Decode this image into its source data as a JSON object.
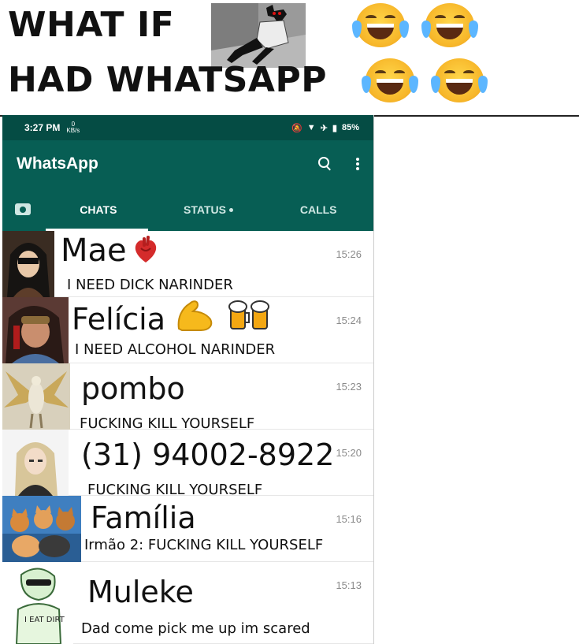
{
  "meme": {
    "line1": "WHAT IF",
    "line2": "HAD WHATSAPP"
  },
  "statusbar": {
    "time": "3:27 PM",
    "speed_value": "0",
    "speed_unit": "KB/s",
    "battery": "85%"
  },
  "appbar": {
    "title": "WhatsApp"
  },
  "tabs": [
    {
      "label": "CHATS",
      "active": true
    },
    {
      "label": "STATUS",
      "active": false
    },
    {
      "label": "CALLS",
      "active": false
    }
  ],
  "chats": [
    {
      "name": "Mae",
      "preview": "I NEED DICK NARINDER",
      "time": "15:26"
    },
    {
      "name": "Felícia",
      "preview": "I NEED ALCOHOL NARINDER",
      "time": "15:24"
    },
    {
      "name": "pombo",
      "preview": "FUCKING KILL YOURSELF",
      "time": "15:23"
    },
    {
      "name": "(31) 94002-8922",
      "preview": "FUCKING KILL YOURSELF",
      "time": "15:20"
    },
    {
      "name": "Família",
      "preview": "Irmão 2: FUCKING KILL YOURSELF",
      "time": "15:16"
    },
    {
      "name": "Muleke",
      "preview": "Dad come pick me up im scared",
      "time": "15:13"
    }
  ],
  "avatar_texts": {
    "muleke_shirt": "I EAT DIRT"
  },
  "colors": {
    "whatsapp_dark": "#054c44",
    "whatsapp_primary": "#075e54",
    "tab_inactive": "#cfe7e3"
  }
}
